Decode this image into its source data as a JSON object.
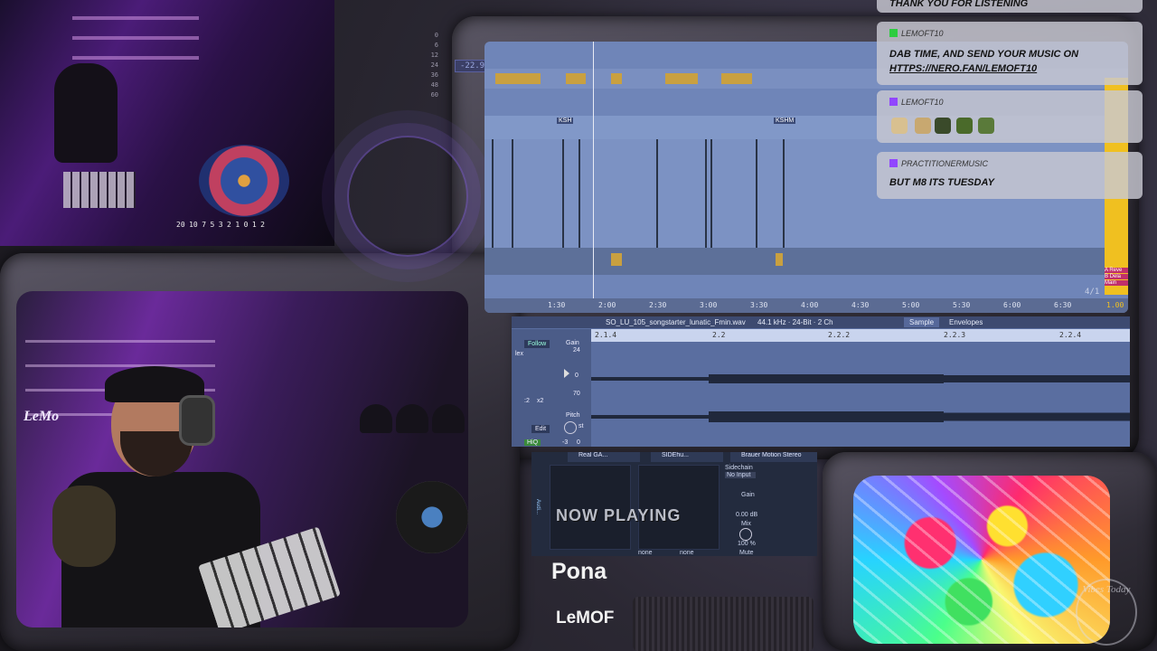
{
  "stream": {
    "meter": {
      "lufs": "-22.9LUFS",
      "scale": [
        "0",
        "6",
        "12",
        "24",
        "36",
        "48",
        "60"
      ],
      "vu_scale": [
        "20",
        "10",
        "7",
        "5",
        "3",
        "2",
        "1",
        "0",
        "1",
        "2"
      ]
    }
  },
  "daw": {
    "arrangement": {
      "timeline": [
        "1:30",
        "2:00",
        "2:30",
        "3:00",
        "3:30",
        "4:00",
        "4:30",
        "5:00",
        "5:30",
        "6:00",
        "6:30"
      ],
      "clip_labels": [
        "KSH",
        "KSHM"
      ],
      "time_signature": "4/1",
      "track_labels": [
        "A Reve",
        "B Dela",
        "Main"
      ],
      "end_marker": "1.00"
    },
    "clip_view": {
      "filename": "SO_LU_105_songstarter_lunatic_Fmin.wav",
      "file_info": "44.1 kHz · 24-Bit · 2 Ch",
      "tabs": [
        "Sample",
        "Envelopes"
      ],
      "ruler": [
        "2.1.4",
        "2.2",
        "2.2.2",
        "2.2.3",
        "2.2.4"
      ],
      "follow_label": "Follow",
      "gain_label": "Gain",
      "gain_values": [
        "24",
        "0",
        "70"
      ],
      "pitch_label": "Pitch",
      "pitch_value": "-3",
      "pitch_cents": "0",
      "pitch_unit": "st",
      "edit_label": "Edit",
      "hiq_label": "HiQ",
      "warp_buttons": [
        ":2",
        "x2"
      ],
      "warp_mode": "lex"
    },
    "devices": {
      "names": [
        "Real GA...",
        "SIDEhu...",
        "Brauer Motion Stereo"
      ],
      "sidechain_label": "Sidechain",
      "input_value": "No Input",
      "gain_label": "Gain",
      "gain_value": "0.00 dB",
      "mix_label": "Mix",
      "mix_value": "100 %",
      "none_values": [
        "none",
        "none"
      ],
      "mute_label": "Mute",
      "side_label": "Audi..."
    }
  },
  "now_playing": {
    "label": "NOW PLAYING",
    "title": "Pona",
    "artist": "LeMOF"
  },
  "chat": {
    "messages": [
      {
        "user": "",
        "text": "THANK YOU FOR LISTENING"
      },
      {
        "user": "LEMOFT10",
        "text": "DAB TIME, AND SEND YOUR MUSIC ON",
        "link": "HTTPS://NERO.FAN/LEMOFT10"
      },
      {
        "user": "LEMOFT10",
        "text": "",
        "emotes": [
          "emote-1",
          "emote-2",
          "emote-3",
          "emote-4",
          "emote-5"
        ]
      },
      {
        "user": "PRACTITIONERMUSIC",
        "text": "BUT M8 ITS TUESDAY"
      }
    ]
  },
  "watermark": "Vibes Today",
  "colors": {
    "daw_blue": "#6f85b8",
    "clip_gold": "#c9a040",
    "yellow_track": "#f0c020",
    "twitch_purple": "#9146ff",
    "chat_green_badge": "#2ecc40"
  }
}
